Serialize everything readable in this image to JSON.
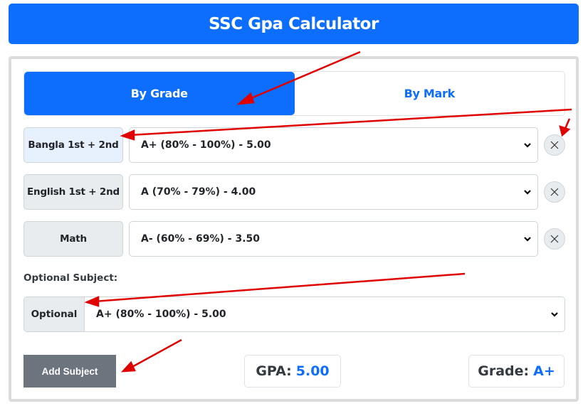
{
  "header": {
    "title": "SSC Gpa Calculator"
  },
  "tabs": [
    {
      "label": "By Grade",
      "active": true
    },
    {
      "label": "By Mark",
      "active": false
    }
  ],
  "subjects": [
    {
      "name": "Bangla 1st + 2nd",
      "selected_grade": "A+ (80% - 100%) - 5.00",
      "highlighted": true
    },
    {
      "name": "English 1st + 2nd",
      "selected_grade": "A (70% - 79%) - 4.00",
      "highlighted": false
    },
    {
      "name": "Math",
      "selected_grade": "A- (60% - 69%) - 3.50",
      "highlighted": false
    }
  ],
  "optional": {
    "heading": "Optional Subject:",
    "label": "Optional",
    "selected_grade": "A+ (80% - 100%) - 5.00"
  },
  "actions": {
    "add_subject_label": "Add Subject"
  },
  "results": {
    "gpa_label": "GPA:",
    "gpa_value": "5.00",
    "grade_label": "Grade:",
    "grade_value": "A+"
  },
  "icons": {
    "remove": "close-icon",
    "dropdown": "chevron-down-icon"
  },
  "colors": {
    "primary": "#0d6efd",
    "secondary": "#6c757d",
    "annotation": "#e00000"
  }
}
